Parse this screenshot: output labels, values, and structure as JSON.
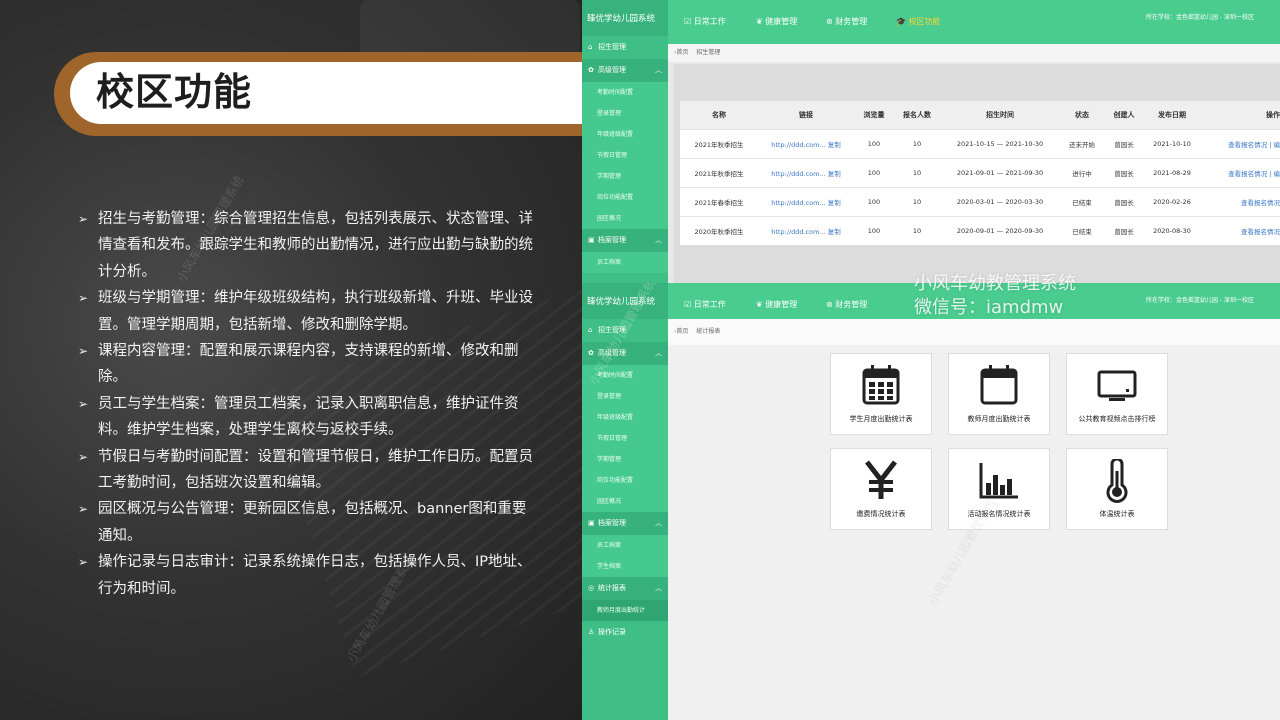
{
  "slide": {
    "title": "校区功能",
    "features": [
      "招生与考勤管理：综合管理招生信息，包括列表展示、状态管理、详情查看和发布。跟踪学生和教师的出勤情况，进行应出勤与缺勤的统计分析。",
      "班级与学期管理：维护年级班级结构，执行班级新增、升班、毕业设置。管理学期周期，包括新增、修改和删除学期。",
      "课程内容管理：配置和展示课程内容，支持课程的新增、修改和删除。",
      "员工与学生档案：管理员工档案，记录入职离职信息，维护证件资料。维护学生档案，处理学生离校与返校手续。",
      "节假日与考勤时间配置：设置和管理节假日，维护工作日历。配置员工考勤时间，包括班次设置和编辑。",
      "园区概况与公告管理：更新园区信息，包括概况、banner图和重要通知。",
      "操作记录与日志审计：记录系统操作日志，包括操作人员、IP地址、行为和时间。"
    ]
  },
  "watermarks": {
    "left": "小风车幼儿园管理系统",
    "overlay_line1": "小风车幼教管理系统",
    "overlay_line2": "微信号：iamdmw"
  },
  "app": {
    "brand": "臻优学幼儿园系统",
    "nav": [
      "日常工作",
      "健康管理",
      "财务管理",
      "校区功能"
    ],
    "school": "所在学校：金色摇篮幼儿园 - 深圳一校区",
    "home": "首页"
  },
  "screen1": {
    "breadcrumb": "招生管理",
    "sidebar": {
      "top": "招生管理",
      "group": "高级管理",
      "subs": [
        "考勤时间配置",
        "登录管理",
        "年级班级配置",
        "节假日管理",
        "学期管理",
        "岗位功能配置",
        "园区概况"
      ],
      "group2": "档案管理",
      "subs2": [
        "员工档案"
      ]
    },
    "table": {
      "headers": [
        "名称",
        "链接",
        "浏览量",
        "报名人数",
        "招生时间",
        "状态",
        "创建人",
        "发布日期",
        "操作"
      ],
      "rows": [
        {
          "name": "2021年秋季招生",
          "link": "http://ddd.com...",
          "copy": "复制",
          "views": "100",
          "signups": "10",
          "period": "2021-10-15 — 2021-10-30",
          "status": "还未开始",
          "creator": "曾园长",
          "date": "2021-10-10",
          "op": "查看报名情况 | 编"
        },
        {
          "name": "2021年秋季招生",
          "link": "http://ddd.com...",
          "copy": "复制",
          "views": "100",
          "signups": "10",
          "period": "2021-09-01 — 2021-09-30",
          "status": "进行中",
          "creator": "曾园长",
          "date": "2021-08-29",
          "op": "查看报名情况 | 编"
        },
        {
          "name": "2021年春季招生",
          "link": "http://ddd.com...",
          "copy": "复制",
          "views": "100",
          "signups": "10",
          "period": "2020-03-01 — 2020-03-30",
          "status": "已结束",
          "creator": "曾园长",
          "date": "2020-02-26",
          "op": "查看报名情况"
        },
        {
          "name": "2020年秋季招生",
          "link": "http://ddd.com...",
          "copy": "复制",
          "views": "100",
          "signups": "10",
          "period": "2020-09-01 — 2020-09-30",
          "status": "已结束",
          "creator": "曾园长",
          "date": "2020-08-30",
          "op": "查看报名情况"
        }
      ]
    }
  },
  "screen2": {
    "breadcrumb": "统计报表",
    "sidebar": {
      "top": "招生管理",
      "group": "高级管理",
      "subs": [
        "考勤时间配置",
        "登录管理",
        "年级班级配置",
        "节假日管理",
        "学期管理",
        "岗位功能配置",
        "园区概况"
      ],
      "group2": "档案管理",
      "subs2": [
        "员工档案",
        "学生档案"
      ],
      "group3": "统计报表",
      "subs3": [
        "教师月度出勤统计"
      ],
      "bottom": "操作记录"
    },
    "cards": [
      {
        "label": "学生月度出勤统计表",
        "icon": "calendar-grid-icon"
      },
      {
        "label": "教师月度出勤统计表",
        "icon": "calendar-icon"
      },
      {
        "label": "公共教育视频点击排行榜",
        "icon": "monitor-icon"
      },
      {
        "label": "缴费情况统计表",
        "icon": "yuan-icon"
      },
      {
        "label": "活动报名情况统计表",
        "icon": "bar-chart-icon"
      },
      {
        "label": "体温统计表",
        "icon": "thermometer-icon"
      }
    ]
  }
}
